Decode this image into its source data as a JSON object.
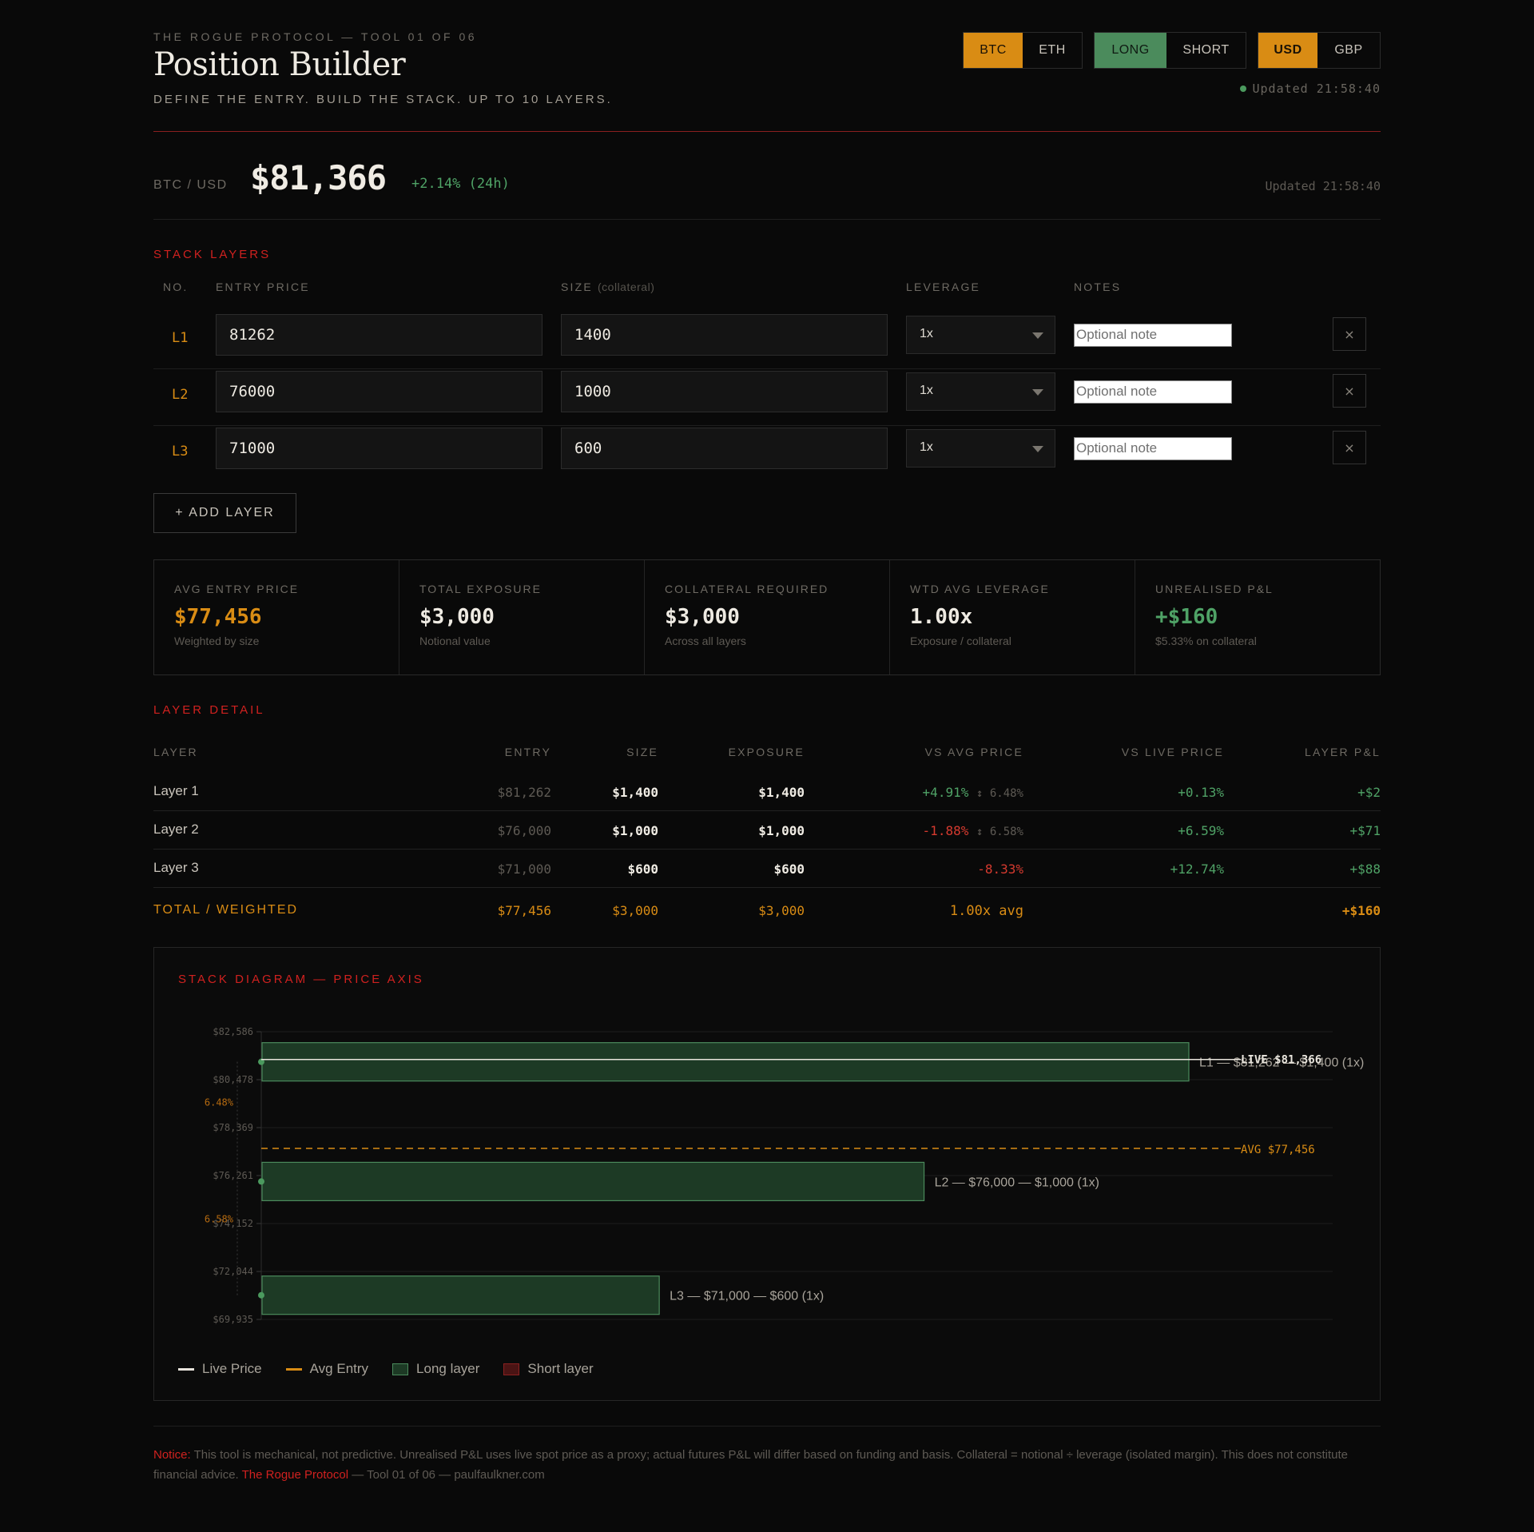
{
  "header": {
    "eyebrow": "THE ROGUE PROTOCOL — TOOL 01 OF 06",
    "title": "Position Builder",
    "subtitle": "DEFINE THE ENTRY. BUILD THE STACK. UP TO 10 LAYERS.",
    "updated": "Updated 21:58:40"
  },
  "toggles": {
    "asset": {
      "options": [
        "BTC",
        "ETH"
      ],
      "selected": "BTC"
    },
    "direction": {
      "options": [
        "LONG",
        "SHORT"
      ],
      "selected": "LONG"
    },
    "currency": {
      "options": [
        "USD",
        "GBP"
      ],
      "selected": "USD"
    }
  },
  "ticker": {
    "pair": "BTC / USD",
    "price": "$81,366",
    "change": "+2.14% (24h)",
    "updated": "Updated 21:58:40"
  },
  "stack": {
    "section_title": "STACK LAYERS",
    "columns": {
      "no": "NO.",
      "entry": "ENTRY PRICE",
      "size": "SIZE",
      "size_note": "(collateral)",
      "leverage": "LEVERAGE",
      "notes": "NOTES"
    },
    "layers": [
      {
        "no": "L1",
        "entry": "81262",
        "size": "1400",
        "leverage": "1x",
        "note_placeholder": "Optional note",
        "remove": "×"
      },
      {
        "no": "L2",
        "entry": "76000",
        "size": "1000",
        "leverage": "1x",
        "note_placeholder": "Optional note",
        "remove": "×"
      },
      {
        "no": "L3",
        "entry": "71000",
        "size": "600",
        "leverage": "1x",
        "note_placeholder": "Optional note",
        "remove": "×"
      }
    ],
    "add_label": "+ ADD LAYER"
  },
  "stats": [
    {
      "label": "AVG ENTRY PRICE",
      "value": "$77,456",
      "sub": "Weighted by size"
    },
    {
      "label": "TOTAL EXPOSURE",
      "value": "$3,000",
      "sub": "Notional value"
    },
    {
      "label": "COLLATERAL REQUIRED",
      "value": "$3,000",
      "sub": "Across all layers"
    },
    {
      "label": "WTD AVG LEVERAGE",
      "value": "1.00x",
      "sub": "Exposure / collateral"
    },
    {
      "label": "UNREALISED P&L",
      "value": "+$160",
      "sub": "$5.33% on collateral"
    }
  ],
  "detail": {
    "section_title": "LAYER DETAIL",
    "headers": [
      "LAYER",
      "ENTRY",
      "SIZE",
      "EXPOSURE",
      "VS AVG PRICE",
      "VS LIVE PRICE",
      "LAYER P&L"
    ],
    "rows": [
      {
        "layer": "Layer 1",
        "entry": "$81,262",
        "size": "$1,400",
        "exposure": "$1,400",
        "vs_avg": "+4.91%",
        "gap": "↕ 6.48%",
        "vs_live": "+0.13%",
        "pnl": "+$2"
      },
      {
        "layer": "Layer 2",
        "entry": "$76,000",
        "size": "$1,000",
        "exposure": "$1,000",
        "vs_avg": "-1.88%",
        "gap": "↕ 6.58%",
        "vs_live": "+6.59%",
        "pnl": "+$71"
      },
      {
        "layer": "Layer 3",
        "entry": "$71,000",
        "size": "$600",
        "exposure": "$600",
        "vs_avg": "-8.33%",
        "gap": "",
        "vs_live": "+12.74%",
        "pnl": "+$88"
      }
    ],
    "total": {
      "label": "TOTAL / WEIGHTED",
      "entry": "$77,456",
      "size": "$3,000",
      "exposure": "$3,000",
      "lev": "1.00x avg",
      "pnl": "+$160"
    }
  },
  "diagram": {
    "title": "STACK DIAGRAM — PRICE AXIS",
    "legend": [
      "Live Price",
      "Avg Entry",
      "Long layer",
      "Short layer"
    ],
    "colors": {
      "live": "#e8e4dc",
      "avg": "#d98c14",
      "long_fill": "#1d3a25",
      "long_stroke": "#4b8b5c",
      "short": "#6a1a1a"
    }
  },
  "chart_data": {
    "type": "bar",
    "orientation": "horizontal",
    "title": "STACK DIAGRAM — PRICE AXIS",
    "y_ticks": [
      "$82,586",
      "$80,478",
      "$78,369",
      "$76,261",
      "$74,152",
      "$72,044",
      "$69,935"
    ],
    "ylim": [
      69935,
      82586
    ],
    "live_price": 81366,
    "live_label": "LIVE $81,366",
    "avg_entry": 77456,
    "avg_label": "AVG $77,456",
    "gap_labels": [
      "6.48%",
      "6.58%"
    ],
    "layers": [
      {
        "entry": 81262,
        "size": 1400,
        "label": "L1 — $81,262 — $1,400 (1x)"
      },
      {
        "entry": 76000,
        "size": 1000,
        "label": "L2 — $76,000 — $1,000 (1x)"
      },
      {
        "entry": 71000,
        "size": 600,
        "label": "L3 — $71,000 — $600 (1x)"
      }
    ],
    "size_max": 1400
  },
  "footer": {
    "notice_label": "Notice:",
    "notice_text": " This tool is mechanical, not predictive. Unrealised P&L uses live spot price as a proxy; actual futures P&L will differ based on funding and basis. Collateral = notional ÷ leverage (isolated margin). This does not constitute financial advice. ",
    "brand": "The Rogue Protocol",
    "tail": " — Tool 01 of 06 — paulfaulkner.com"
  }
}
